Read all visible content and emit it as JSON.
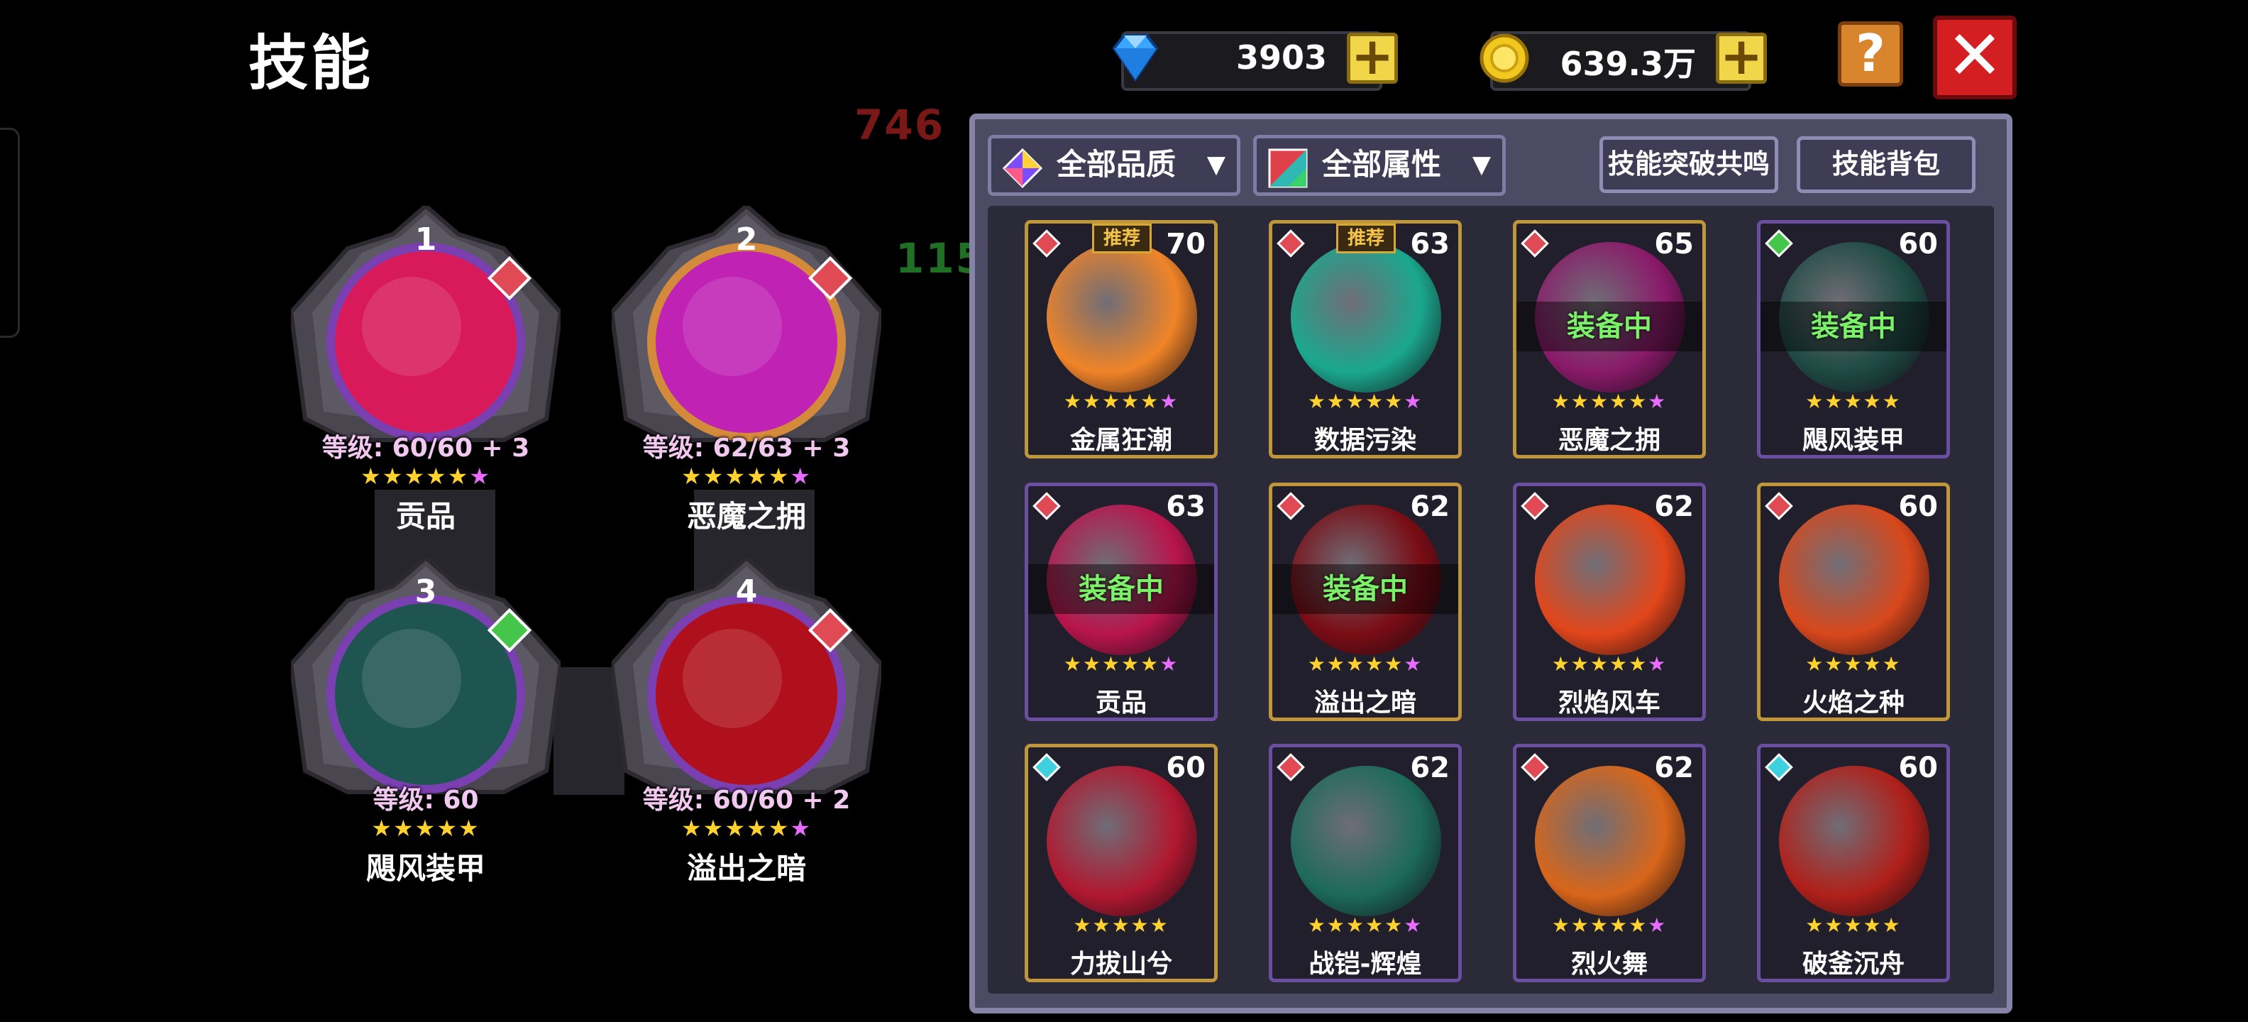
{
  "header": {
    "title": "技能",
    "diamonds": "3903",
    "gold": "639.3万",
    "plus_label": "+",
    "help_label": "?",
    "close_label": "✕"
  },
  "floating_numbers": [
    {
      "text": "746",
      "color": "#7a1818"
    },
    {
      "text": "115",
      "color": "#1f6f24"
    }
  ],
  "equipped": [
    {
      "slot": "1",
      "level": "等级: 60/60 + 3",
      "name": "贡品",
      "stars": "★★★★★",
      "purple_star": "★",
      "gem": "#e04a55",
      "art": "#d81a5a",
      "ring": "#7a3fb0"
    },
    {
      "slot": "2",
      "level": "等级: 62/63 + 3",
      "name": "恶魔之拥",
      "stars": "★★★★★",
      "purple_star": "★",
      "gem": "#e04a55",
      "art": "#c022b4",
      "ring": "#d38a3a"
    },
    {
      "slot": "3",
      "level": "等级: 60",
      "name": "飓风装甲",
      "stars": "★★★★★",
      "purple_star": "",
      "gem": "#45c64a",
      "art": "#1f5550",
      "ring": "#7a3fb0"
    },
    {
      "slot": "4",
      "level": "等级: 60/60 + 2",
      "name": "溢出之暗",
      "stars": "★★★★★",
      "purple_star": "★",
      "gem": "#e04a55",
      "art": "#b0101c",
      "ring": "#7a3fb0"
    }
  ],
  "filters": {
    "quality": "全部品质",
    "attribute": "全部属性",
    "resonance": "技能突破共鸣",
    "bag": "技能背包"
  },
  "recommend_label": "推荐",
  "equipped_label": "装备中",
  "skills": [
    {
      "name": "金属狂潮",
      "level": "70",
      "stars": "★★★★★",
      "purple_star": "★",
      "gem": "#e04a55",
      "art": "#f08428",
      "recommend": true,
      "equipped": false,
      "frame": "gold"
    },
    {
      "name": "数据污染",
      "level": "63",
      "stars": "★★★★★",
      "purple_star": "★",
      "gem": "#e04a55",
      "art": "#1aa88e",
      "recommend": true,
      "equipped": false,
      "frame": "gold"
    },
    {
      "name": "恶魔之拥",
      "level": "65",
      "stars": "★★★★★",
      "purple_star": "★",
      "gem": "#e04a55",
      "art": "#8a1a6a",
      "recommend": false,
      "equipped": true,
      "frame": "gold"
    },
    {
      "name": "飓风装甲",
      "level": "60",
      "stars": "★★★★★",
      "purple_star": "",
      "gem": "#45c64a",
      "art": "#1e4a44",
      "recommend": false,
      "equipped": true,
      "frame": "purple"
    },
    {
      "name": "贡品",
      "level": "63",
      "stars": "★★★★★",
      "purple_star": "★",
      "gem": "#e04a55",
      "art": "#b8154c",
      "recommend": false,
      "equipped": true,
      "frame": "purple"
    },
    {
      "name": "溢出之暗",
      "level": "62",
      "stars": "★★★★★",
      "purple_star": "★",
      "gem": "#e04a55",
      "art": "#7a0c14",
      "recommend": false,
      "equipped": true,
      "frame": "gold"
    },
    {
      "name": "烈焰风车",
      "level": "62",
      "stars": "★★★★★",
      "purple_star": "★",
      "gem": "#e04a55",
      "art": "#e2461a",
      "recommend": false,
      "equipped": false,
      "frame": "purple"
    },
    {
      "name": "火焰之种",
      "level": "60",
      "stars": "★★★★★",
      "purple_star": "",
      "gem": "#e04a55",
      "art": "#d8481c",
      "recommend": false,
      "equipped": false,
      "frame": "gold"
    },
    {
      "name": "力拔山兮",
      "level": "60",
      "stars": "★★★★★",
      "purple_star": "",
      "gem": "#3fd0e0",
      "art": "#b01830",
      "recommend": false,
      "equipped": false,
      "frame": "gold"
    },
    {
      "name": "战铠-辉煌",
      "level": "62",
      "stars": "★★★★★",
      "purple_star": "★",
      "gem": "#e04a55",
      "art": "#1c6a5a",
      "recommend": false,
      "equipped": false,
      "frame": "purple"
    },
    {
      "name": "烈火舞",
      "level": "62",
      "stars": "★★★★★",
      "purple_star": "★",
      "gem": "#e04a55",
      "art": "#d8661a",
      "recommend": false,
      "equipped": false,
      "frame": "purple"
    },
    {
      "name": "破釜沉舟",
      "level": "60",
      "stars": "★★★★★",
      "purple_star": "",
      "gem": "#3fd0e0",
      "art": "#b0201a",
      "recommend": false,
      "equipped": false,
      "frame": "purple"
    }
  ]
}
